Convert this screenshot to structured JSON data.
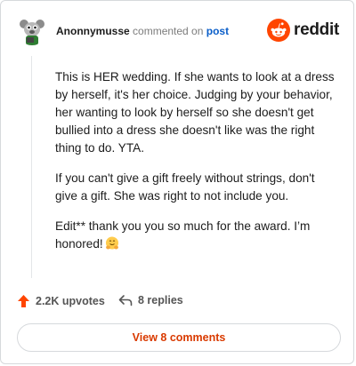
{
  "header": {
    "username": "Anonnymusse",
    "action_text": "commented on",
    "post_link": "post",
    "brand_word": "reddit",
    "brand_color": "#ff4500"
  },
  "comment": {
    "paragraphs": [
      "This is HER wedding. If she wants to look at a dress by herself, it's her choice. Judging by your behavior, her wanting to look by herself so she doesn't get bullied into a dress she doesn't like was the right thing to do. YTA.",
      "If you can't give a gift freely without strings, don't give a gift. She was right to not include you.",
      "Edit** thank you you so much for the award. I’m honored!"
    ],
    "emoji": "hugging-face-emoji"
  },
  "footer": {
    "upvotes": "2.2K upvotes",
    "replies": "8 replies",
    "upvote_color": "#ff4500"
  },
  "view_button": {
    "label": "View 8 comments",
    "color": "#d93a00"
  }
}
